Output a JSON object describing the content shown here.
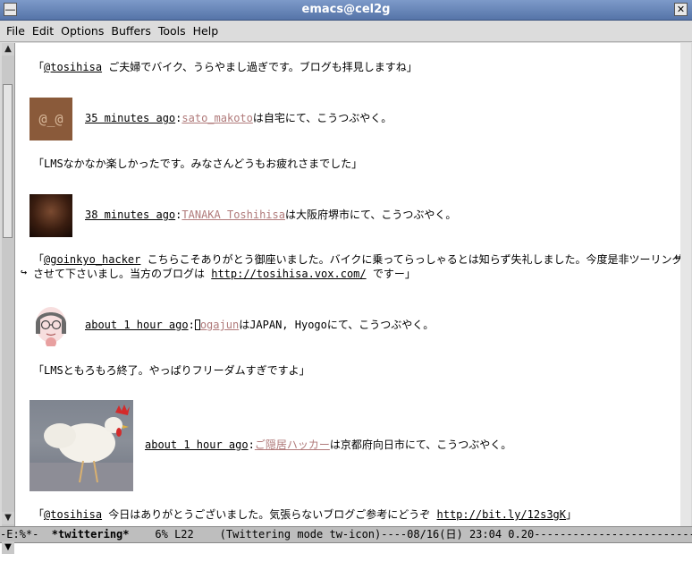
{
  "window": {
    "title": "emacs@cel2g"
  },
  "menu": [
    "File",
    "Edit",
    "Options",
    "Buffers",
    "Tools",
    "Help"
  ],
  "tweets": [
    {
      "text_prefix": "「",
      "mention": "@tosihisa",
      "text_rest": " ご夫婦でバイク、うらやまし過ぎです。ブログも拝見しますね」"
    },
    {
      "time": "35 minutes ago",
      "sep": ":",
      "user": "sato_makoto",
      "loc": "は自宅にて、こうつぶやく。",
      "avatar_text": "@_@",
      "body": "「LMSなかなか楽しかったです。みなさんどうもお疲れさまでした」"
    },
    {
      "time": "38 minutes ago",
      "sep": ":",
      "user": "TANAKA Toshihisa",
      "loc": "は大阪府堺市にて、こうつぶやく。",
      "body_prefix": "「",
      "body_mention": "@goinkyo_hacker",
      "body_line1": " こちらこそありがとう御座いました。バイクに乗ってらっしゃるとは知らず失礼しました。今度是非ツーリング",
      "body_line2a": "させて下さいまし。当方のブログは ",
      "body_link": "http://tosihisa.vox.com/",
      "body_line2b": " ですー」"
    },
    {
      "time": "about 1 hour ago",
      "sep": ":",
      "user": "ogajun",
      "loc": "はJAPAN, Hyogoにて、こうつぶやく。",
      "body": "「LMSともろもろ終了。やっぱりフリーダムすぎですよ」"
    },
    {
      "time": "about 1 hour ago",
      "sep": ":",
      "user": "ご隠居ハッカー",
      "loc": "は京都府向日市にて、こうつぶやく。",
      "body_prefix": "「",
      "body_mention": "@tosihisa",
      "body_mid": " 今日はありがとうございました。気張らないブログご参考にどうぞ  ",
      "body_link": "http://bit.ly/12s3gK",
      "body_suffix": "」"
    }
  ],
  "modeline": {
    "status": "-E:%*-  ",
    "buffer": "*twittering*",
    "rest": "    6% L22    (Twittering mode tw-icon)----08/16(日) 23:04 0.20---------------------------------"
  },
  "colors": {
    "user_link": "#b07a7a",
    "modeline_bg": "#bebebe",
    "titlebar": "#6886b8"
  }
}
